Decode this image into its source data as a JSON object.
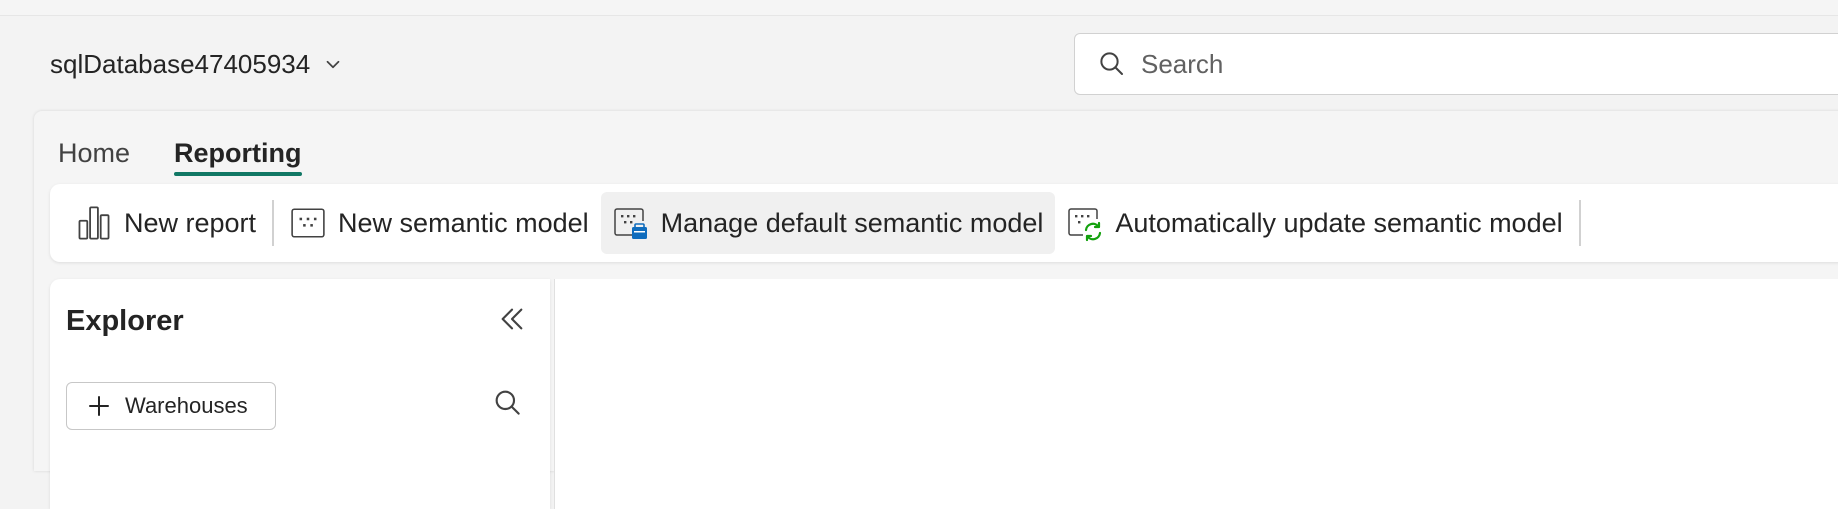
{
  "database": {
    "name": "sqlDatabase47405934"
  },
  "search": {
    "placeholder": "Search"
  },
  "tabs": [
    {
      "label": "Home",
      "active": false
    },
    {
      "label": "Reporting",
      "active": true
    }
  ],
  "ribbon": {
    "new_report": "New report",
    "new_semantic_model": "New semantic model",
    "manage_default_semantic_model": "Manage default semantic model",
    "auto_update_semantic_model": "Automatically update semantic model"
  },
  "explorer": {
    "title": "Explorer",
    "add_warehouses": "Warehouses"
  },
  "colors": {
    "accent": "#117865",
    "icon_blue": "#0f6cbd",
    "icon_green": "#13a10e"
  },
  "icons": [
    "chevron-down-icon",
    "search-icon",
    "bar-chart-icon",
    "semantic-model-icon",
    "manage-semantic-model-icon",
    "auto-update-semantic-model-icon",
    "double-chevron-left-icon",
    "plus-icon"
  ]
}
